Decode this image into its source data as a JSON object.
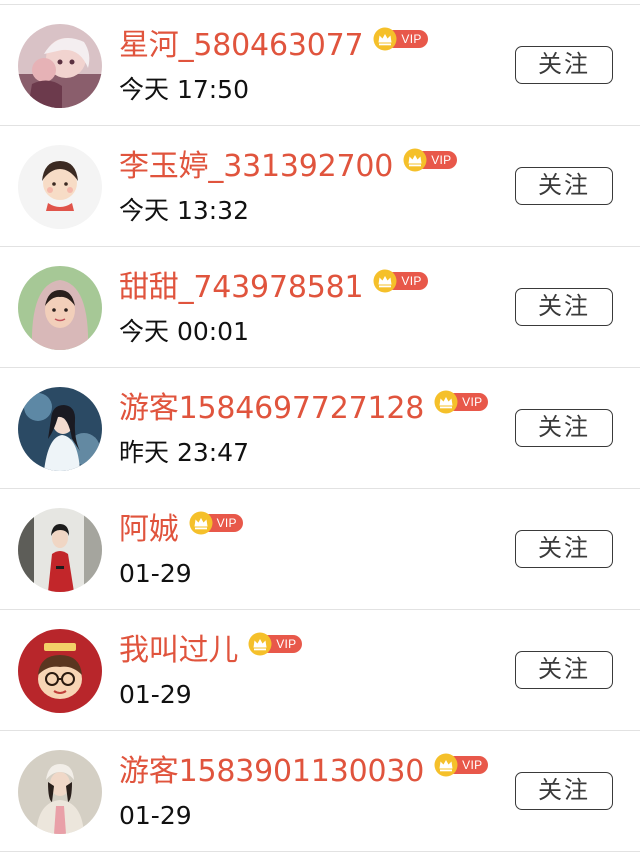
{
  "users": [
    {
      "name": "星河_580463077",
      "time": "今天 17:50",
      "vip_label": "VIP",
      "follow_label": "关注",
      "avatar": "anime-girl-avatar"
    },
    {
      "name": "李玉婷_331392700",
      "time": "今天 13:32",
      "vip_label": "VIP",
      "follow_label": "关注",
      "avatar": "cartoon-girl-avatar"
    },
    {
      "name": "甜甜_743978581",
      "time": "今天 00:01",
      "vip_label": "VIP",
      "follow_label": "关注",
      "avatar": "woman-hood-avatar"
    },
    {
      "name": "游客1584697727128",
      "time": "昨天 23:47",
      "vip_label": "VIP",
      "follow_label": "关注",
      "avatar": "white-dress-avatar"
    },
    {
      "name": "阿娍",
      "time": "01-29",
      "vip_label": "VIP",
      "follow_label": "关注",
      "avatar": "red-costume-avatar"
    },
    {
      "name": "我叫过儿",
      "time": "01-29",
      "vip_label": "VIP",
      "follow_label": "关注",
      "avatar": "glasses-cartoon-avatar"
    },
    {
      "name": "游客1583901130030",
      "time": "01-29",
      "vip_label": "VIP",
      "follow_label": "关注",
      "avatar": "girl-coat-avatar"
    }
  ],
  "colors": {
    "name": "#e0543d",
    "vip": "#e8584a",
    "crown": "#f5c02a",
    "divider": "#e2e2e2"
  }
}
